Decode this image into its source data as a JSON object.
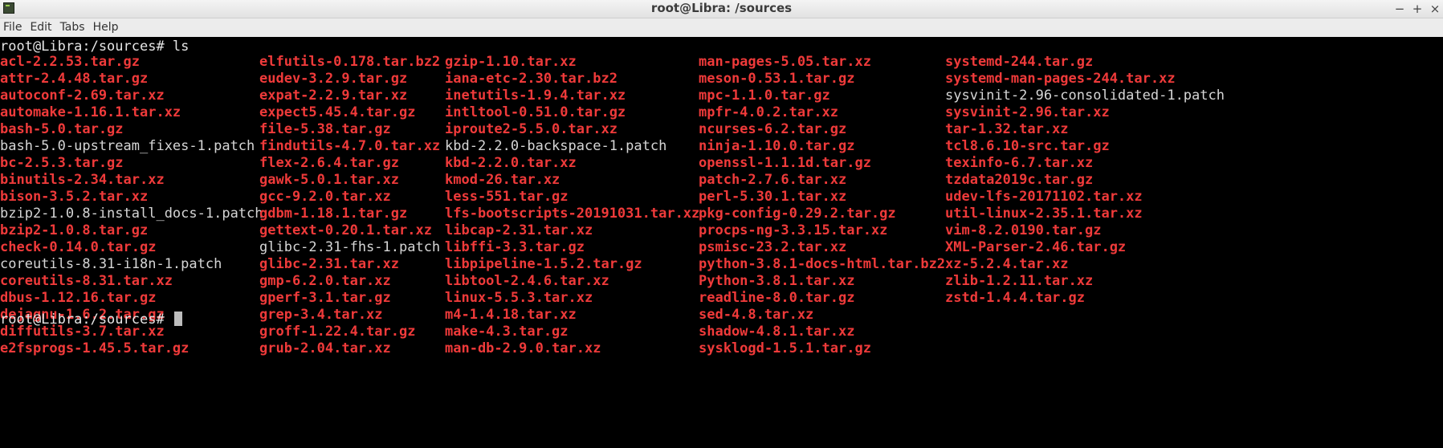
{
  "window": {
    "title": "root@Libra: /sources",
    "minimize_glyph": "−",
    "maximize_glyph": "+",
    "close_glyph": "×"
  },
  "menu": {
    "file": "File",
    "edit": "Edit",
    "tabs": "Tabs",
    "help": "Help"
  },
  "terminal": {
    "command_line": "root@Libra:/sources# ls",
    "prompt": "root@Libra:/sources# ",
    "archive_color": "#ef3a3a",
    "plain_color": "#d6d6d6",
    "columns": [
      [
        {
          "name": "acl-2.2.53.tar.gz",
          "type": "archive"
        },
        {
          "name": "attr-2.4.48.tar.gz",
          "type": "archive"
        },
        {
          "name": "autoconf-2.69.tar.xz",
          "type": "archive"
        },
        {
          "name": "automake-1.16.1.tar.xz",
          "type": "archive"
        },
        {
          "name": "bash-5.0.tar.gz",
          "type": "archive"
        },
        {
          "name": "bash-5.0-upstream_fixes-1.patch",
          "type": "plain"
        },
        {
          "name": "bc-2.5.3.tar.gz",
          "type": "archive"
        },
        {
          "name": "binutils-2.34.tar.xz",
          "type": "archive"
        },
        {
          "name": "bison-3.5.2.tar.xz",
          "type": "archive"
        },
        {
          "name": "bzip2-1.0.8-install_docs-1.patch",
          "type": "plain"
        },
        {
          "name": "bzip2-1.0.8.tar.gz",
          "type": "archive"
        },
        {
          "name": "check-0.14.0.tar.gz",
          "type": "archive"
        },
        {
          "name": "coreutils-8.31-i18n-1.patch",
          "type": "plain"
        },
        {
          "name": "coreutils-8.31.tar.xz",
          "type": "archive"
        },
        {
          "name": "dbus-1.12.16.tar.gz",
          "type": "archive"
        },
        {
          "name": "dejagnu-1.6.2.tar.gz",
          "type": "archive"
        },
        {
          "name": "diffutils-3.7.tar.xz",
          "type": "archive"
        },
        {
          "name": "e2fsprogs-1.45.5.tar.gz",
          "type": "archive"
        }
      ],
      [
        {
          "name": "elfutils-0.178.tar.bz2",
          "type": "archive"
        },
        {
          "name": "eudev-3.2.9.tar.gz",
          "type": "archive"
        },
        {
          "name": "expat-2.2.9.tar.xz",
          "type": "archive"
        },
        {
          "name": "expect5.45.4.tar.gz",
          "type": "archive"
        },
        {
          "name": "file-5.38.tar.gz",
          "type": "archive"
        },
        {
          "name": "findutils-4.7.0.tar.xz",
          "type": "archive"
        },
        {
          "name": "flex-2.6.4.tar.gz",
          "type": "archive"
        },
        {
          "name": "gawk-5.0.1.tar.xz",
          "type": "archive"
        },
        {
          "name": "gcc-9.2.0.tar.xz",
          "type": "archive"
        },
        {
          "name": "gdbm-1.18.1.tar.gz",
          "type": "archive"
        },
        {
          "name": "gettext-0.20.1.tar.xz",
          "type": "archive"
        },
        {
          "name": "glibc-2.31-fhs-1.patch",
          "type": "plain"
        },
        {
          "name": "glibc-2.31.tar.xz",
          "type": "archive"
        },
        {
          "name": "gmp-6.2.0.tar.xz",
          "type": "archive"
        },
        {
          "name": "gperf-3.1.tar.gz",
          "type": "archive"
        },
        {
          "name": "grep-3.4.tar.xz",
          "type": "archive"
        },
        {
          "name": "groff-1.22.4.tar.gz",
          "type": "archive"
        },
        {
          "name": "grub-2.04.tar.xz",
          "type": "archive"
        }
      ],
      [
        {
          "name": "gzip-1.10.tar.xz",
          "type": "archive"
        },
        {
          "name": "iana-etc-2.30.tar.bz2",
          "type": "archive"
        },
        {
          "name": "inetutils-1.9.4.tar.xz",
          "type": "archive"
        },
        {
          "name": "intltool-0.51.0.tar.gz",
          "type": "archive"
        },
        {
          "name": "iproute2-5.5.0.tar.xz",
          "type": "archive"
        },
        {
          "name": "kbd-2.2.0-backspace-1.patch",
          "type": "plain"
        },
        {
          "name": "kbd-2.2.0.tar.xz",
          "type": "archive"
        },
        {
          "name": "kmod-26.tar.xz",
          "type": "archive"
        },
        {
          "name": "less-551.tar.gz",
          "type": "archive"
        },
        {
          "name": "lfs-bootscripts-20191031.tar.xz",
          "type": "archive"
        },
        {
          "name": "libcap-2.31.tar.xz",
          "type": "archive"
        },
        {
          "name": "libffi-3.3.tar.gz",
          "type": "archive"
        },
        {
          "name": "libpipeline-1.5.2.tar.gz",
          "type": "archive"
        },
        {
          "name": "libtool-2.4.6.tar.xz",
          "type": "archive"
        },
        {
          "name": "linux-5.5.3.tar.xz",
          "type": "archive"
        },
        {
          "name": "m4-1.4.18.tar.xz",
          "type": "archive"
        },
        {
          "name": "make-4.3.tar.gz",
          "type": "archive"
        },
        {
          "name": "man-db-2.9.0.tar.xz",
          "type": "archive"
        }
      ],
      [
        {
          "name": "man-pages-5.05.tar.xz",
          "type": "archive"
        },
        {
          "name": "meson-0.53.1.tar.gz",
          "type": "archive"
        },
        {
          "name": "mpc-1.1.0.tar.gz",
          "type": "archive"
        },
        {
          "name": "mpfr-4.0.2.tar.xz",
          "type": "archive"
        },
        {
          "name": "ncurses-6.2.tar.gz",
          "type": "archive"
        },
        {
          "name": "ninja-1.10.0.tar.gz",
          "type": "archive"
        },
        {
          "name": "openssl-1.1.1d.tar.gz",
          "type": "archive"
        },
        {
          "name": "patch-2.7.6.tar.xz",
          "type": "archive"
        },
        {
          "name": "perl-5.30.1.tar.xz",
          "type": "archive"
        },
        {
          "name": "pkg-config-0.29.2.tar.gz",
          "type": "archive"
        },
        {
          "name": "procps-ng-3.3.15.tar.xz",
          "type": "archive"
        },
        {
          "name": "psmisc-23.2.tar.xz",
          "type": "archive"
        },
        {
          "name": "python-3.8.1-docs-html.tar.bz2",
          "type": "archive"
        },
        {
          "name": "Python-3.8.1.tar.xz",
          "type": "archive"
        },
        {
          "name": "readline-8.0.tar.gz",
          "type": "archive"
        },
        {
          "name": "sed-4.8.tar.xz",
          "type": "archive"
        },
        {
          "name": "shadow-4.8.1.tar.xz",
          "type": "archive"
        },
        {
          "name": "sysklogd-1.5.1.tar.gz",
          "type": "archive"
        }
      ],
      [
        {
          "name": "systemd-244.tar.gz",
          "type": "archive"
        },
        {
          "name": "systemd-man-pages-244.tar.xz",
          "type": "archive"
        },
        {
          "name": "sysvinit-2.96-consolidated-1.patch",
          "type": "plain"
        },
        {
          "name": "sysvinit-2.96.tar.xz",
          "type": "archive"
        },
        {
          "name": "tar-1.32.tar.xz",
          "type": "archive"
        },
        {
          "name": "tcl8.6.10-src.tar.gz",
          "type": "archive"
        },
        {
          "name": "texinfo-6.7.tar.xz",
          "type": "archive"
        },
        {
          "name": "tzdata2019c.tar.gz",
          "type": "archive"
        },
        {
          "name": "udev-lfs-20171102.tar.xz",
          "type": "archive"
        },
        {
          "name": "util-linux-2.35.1.tar.xz",
          "type": "archive"
        },
        {
          "name": "vim-8.2.0190.tar.gz",
          "type": "archive"
        },
        {
          "name": "XML-Parser-2.46.tar.gz",
          "type": "archive"
        },
        {
          "name": "xz-5.2.4.tar.xz",
          "type": "archive"
        },
        {
          "name": "zlib-1.2.11.tar.xz",
          "type": "archive"
        },
        {
          "name": "zstd-1.4.4.tar.gz",
          "type": "archive"
        }
      ]
    ]
  }
}
